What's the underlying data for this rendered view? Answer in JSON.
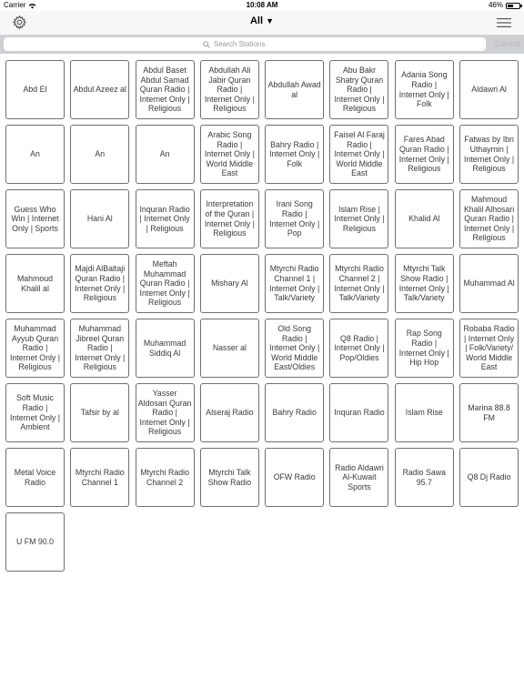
{
  "status": {
    "carrier": "Carrier",
    "time": "10:08 AM",
    "battery": "46%",
    "battery_level": 0.46
  },
  "nav": {
    "title": "All",
    "title_caret": "▼"
  },
  "search": {
    "placeholder": "Search Stations",
    "value": "",
    "cancel_label": "Cancel"
  },
  "stations": [
    "Abd El",
    "Abdul Azeez al",
    "Abdul Baset Abdul Samad Quran Radio | Internet Only | Religious",
    "Abdullah Ali Jabir Quran Radio | Internet Only | Religious",
    "Abdullah Awad al",
    "Abu Bakr Shatry Quran Radio | Internet Only | Religious",
    "Adania Song Radio | Internet Only | Folk",
    "Aldawri Al",
    "An",
    "An",
    "An",
    "Arabic Song Radio | Internet Only | World Middle East",
    "Bahry Radio | Internet Only | Folk",
    "Faisel Al Faraj Radio | Internet Only | World Middle East",
    "Fares Abad Quran Radio | Internet Only | Religious",
    "Fatwas by Ibn Uthaymin | Internet Only | Religious",
    "Guess Who Win | Internet Only | Sports",
    "Hani Al",
    "Inquran Radio | Internet Only | Religious",
    "Interpretation of the Quran | Internet Only | Religious",
    "Irani Song Radio | Internet Only | Pop",
    "Islam Rise | Internet Only | Religious",
    "Khalid Al",
    "Mahmoud Khalil Alhosari Quran Radio | Internet Only | Religious",
    "Mahmoud Khalil al",
    "Majdi AlBaltaji Quran Radio | Internet Only | Religious",
    "Meftah Muhammad Quran Radio | Internet Only | Religious",
    "Mishary Al",
    "Mtyrchi Radio Channel 1 | Internet Only | Talk/Variety",
    "Mtyrchi Radio Channel 2 | Internet Only | Talk/Variety",
    "Mtyrchi Talk Show Radio | Internet Only | Talk/Variety",
    "Muhammad Al",
    "Muhammad Ayyub Quran Radio | Internet Only | Religious",
    "Muhammad Jibreel Quran Radio | Internet Only | Religious",
    "Muhammad Siddiq Al",
    "Nasser al",
    "Old Song Radio | Internet Only | World Middle East/Oldies",
    "Q8 Radio | Internet Only | Pop/Oldies",
    "Rap Song Radio | Internet Only | Hip Hop",
    "Robaba Radio | Internet Only | Folk/Variety/ World Middle East",
    "Soft Music Radio | Internet Only | Ambient",
    "Tafsir by al",
    "Yasser Aldosari Quran Radio | Internet Only | Religious",
    "Alseraj Radio",
    "Bahry Radio",
    "Inquran Radio",
    "Islam Rise",
    "Marina 88.8 FM",
    "Metal Voice Radio",
    "Mtyrchi Radio Channel 1",
    "Mtyrchi Radio Channel 2",
    "Mtyrchi Talk Show Radio",
    "OFW Radio",
    "Radio Aldawri Al-Kuwait Sports",
    "Radio Sawa 95.7",
    "Q8 Dj Radio",
    "U FM 90.0"
  ],
  "icons": {
    "settings": "gear-icon",
    "menu": "hamburger-menu-icon",
    "search": "search-icon",
    "wifi": "wifi-icon"
  },
  "colors": {
    "tile_border": "#707070",
    "nav_background": "#f7f7f7",
    "search_bar_background": "#cfd0d3"
  }
}
